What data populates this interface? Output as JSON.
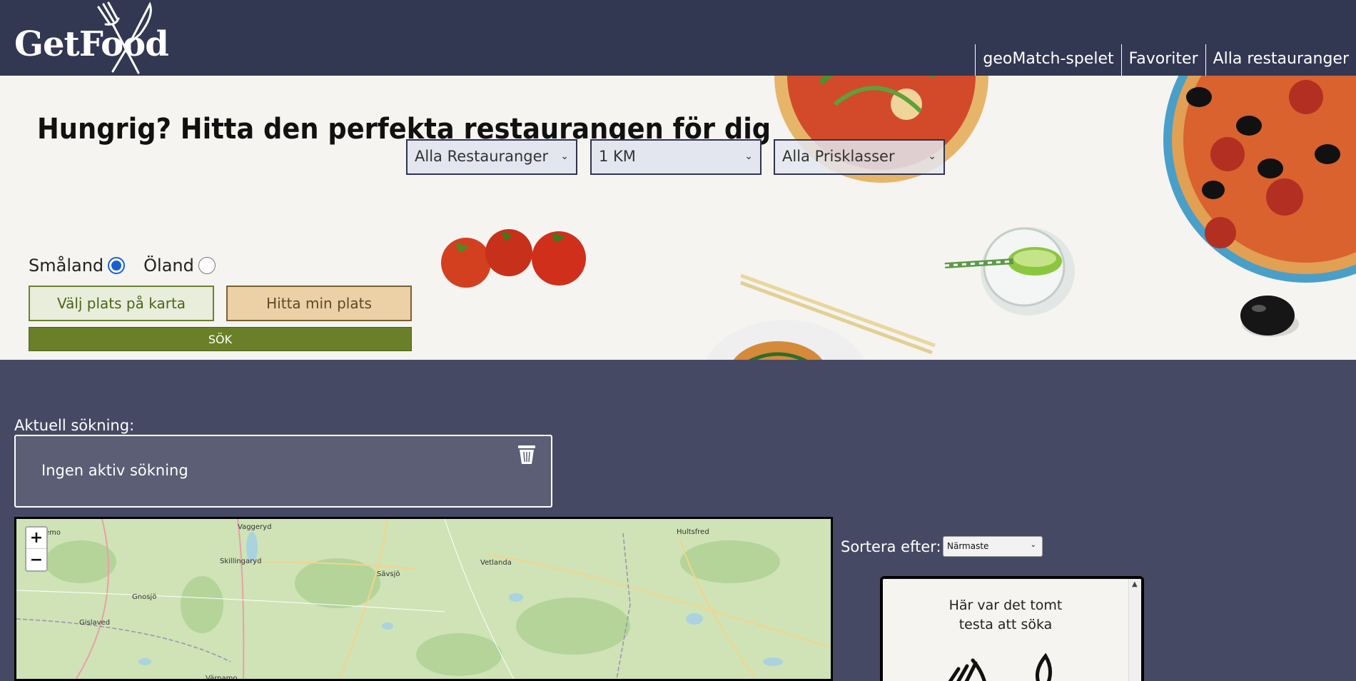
{
  "header": {
    "logo_text": "GetFood",
    "nav": [
      "geoMatch-spelet",
      "Favoriter",
      "Alla restauranger"
    ]
  },
  "hero": {
    "title": "Hungrig? Hitta den perfekta restaurangen för dig",
    "filters": {
      "category": "Alla Restauranger",
      "distance": "1 KM",
      "price": "Alla Prisklasser"
    },
    "regions": [
      {
        "label": "Småland",
        "checked": true
      },
      {
        "label": "Öland",
        "checked": false
      }
    ],
    "choose_on_map_label": "Välj plats på karta",
    "find_location_label": "Hitta min plats",
    "search_label": "SÖK"
  },
  "current_search": {
    "label": "Aktuell sökning:",
    "text": "Ingen aktiv sökning"
  },
  "map": {
    "zoom_in": "+",
    "zoom_out": "−",
    "places": [
      "emo",
      "Vaggeryd",
      "Skillingaryd",
      "Sävsjö",
      "Vetlanda",
      "Hultsfred",
      "Gnosjö",
      "Gislaved",
      "Värnamo"
    ]
  },
  "sort": {
    "label": "Sortera efter:",
    "selected": "Närmaste"
  },
  "results": {
    "empty_line1": "Här var det tomt",
    "empty_line2": "testa att söka"
  },
  "colors": {
    "header_bg": "#323752",
    "page_bg": "#464964",
    "search_button": "#6a8028"
  }
}
